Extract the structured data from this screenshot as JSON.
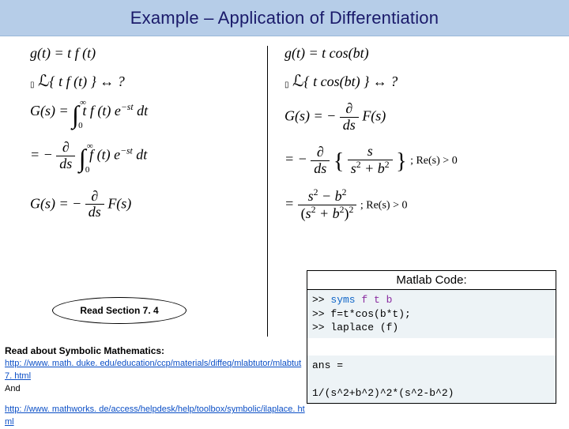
{
  "title": "Example – Application of Differentiation",
  "left": {
    "eq1": "g(t) = t f (t)",
    "eq2_pre": "{ t f (t) } ↔ ?",
    "eq3_lhs": "G(s) = ",
    "eq3_int_up": "∞",
    "eq3_int_lo": "0",
    "eq3_rhs": " t f (t) e",
    "eq3_exp": "−st",
    "eq3_dt": " dt",
    "eq4_pre": "= − ",
    "eq4_frac_num": "∂",
    "eq4_frac_den": "ds",
    "eq4_int_up": "∞",
    "eq4_int_lo": "0",
    "eq4_mid": " f (t) e",
    "eq4_exp": "−st",
    "eq4_dt": " dt",
    "eq5_lhs": "G(s) = − ",
    "eq5_frac_num": "∂",
    "eq5_frac_den": "ds",
    "eq5_rhs": " F(s)"
  },
  "right": {
    "eq1": "g(t) = t cos(bt)",
    "eq2": "{ t cos(bt) } ↔ ?",
    "eq3_lhs": "G(s) = − ",
    "eq3_frac_num": "∂",
    "eq3_frac_den": "ds",
    "eq3_rhs": " F(s)",
    "eq4_pre": "= − ",
    "eq4_frac_num": "∂",
    "eq4_frac_den": "ds",
    "eq4_brace_num": "s",
    "eq4_brace_den_a": "s",
    "eq4_brace_den_b": " + b",
    "eq4_re": "; Re(s) > 0",
    "eq5_pre": "= ",
    "eq5_num_a": "s",
    "eq5_num_b": " − b",
    "eq5_den_a": "s",
    "eq5_den_b": " + b",
    "eq5_re": "; Re(s) > 0"
  },
  "callout": "Read Section 7. 4",
  "matlab": {
    "header": "Matlab Code:",
    "l1a": ">> ",
    "l1b": "syms ",
    "l1c": "f t b",
    "l2a": ">> f=t*cos(b*t);",
    "l3a": ">> laplace (f)",
    "out1": "ans =",
    "out2": "1/(s^2+b^2)^2*(s^2-b^2)"
  },
  "footer": {
    "head": "Read about Symbolic Mathematics:",
    "link1": "http: //www. math. duke. edu/education/ccp/materials/diffeq/mlabtutor/mlabtut 7. html",
    "and": "And",
    "link2": "http: //www. mathworks. de/access/helpdesk/help/toolbox/symbolic/ilaplace. html"
  }
}
